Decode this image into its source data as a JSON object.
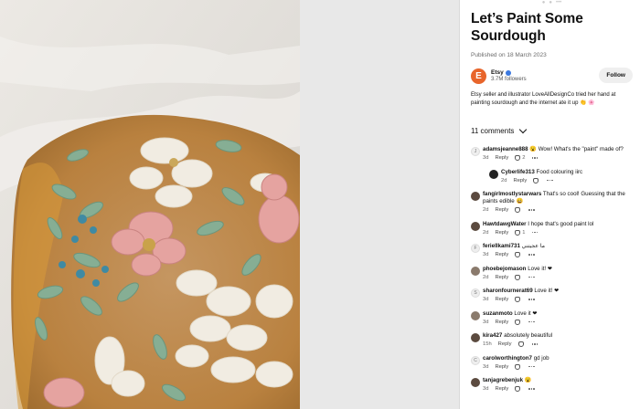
{
  "pin": {
    "title_line1": "Let’s Paint Some",
    "title_line2": "Sourdough",
    "published": "Published on 18 March 2023",
    "author_initial": "E",
    "author_name": "Etsy",
    "followers": "3.7M followers",
    "follow_label": "Follow",
    "description": "Etsy seller and illustrator LoveAllDesignCo tried her hand at painting sourdough and the internet ate it up 👏 🌸"
  },
  "comments_header": "11 comments",
  "comments": [
    {
      "avatar": "J",
      "style": "letter",
      "user": "adamsjeanne888",
      "text": "😮 Wow! What's the \"paint\" made of?",
      "time": "3d",
      "reply": "Reply",
      "likes": "2",
      "is_reply": false
    },
    {
      "avatar": "",
      "style": "dark",
      "user": "Cyberlife313",
      "text": "Food colouring iirc",
      "time": "2d",
      "reply": "Reply",
      "likes": "",
      "is_reply": true
    },
    {
      "avatar": "",
      "style": "photo",
      "user": "fangirlmostlystarwars",
      "text": "That's so cool! Guessing that the paints edible 😄",
      "time": "2d",
      "reply": "Reply",
      "likes": "",
      "is_reply": false
    },
    {
      "avatar": "",
      "style": "photo",
      "user": "HawtdawgWater",
      "text": "I hope that's good paint lol",
      "time": "2d",
      "reply": "Reply",
      "likes": "1",
      "is_reply": false
    },
    {
      "avatar": "F",
      "style": "letter",
      "user": "feriellkami731",
      "text": "ما عجيتني",
      "time": "3d",
      "reply": "Reply",
      "likes": "",
      "is_reply": false
    },
    {
      "avatar": "",
      "style": "mid",
      "user": "phoebejomason",
      "text": "Love it! ❤",
      "time": "2d",
      "reply": "Reply",
      "likes": "",
      "is_reply": false
    },
    {
      "avatar": "S",
      "style": "letter",
      "user": "sharonfournerat69",
      "text": "Love it! ❤",
      "time": "3d",
      "reply": "Reply",
      "likes": "",
      "is_reply": false
    },
    {
      "avatar": "",
      "style": "mid",
      "user": "suzanmoto",
      "text": "Love it ❤",
      "time": "3d",
      "reply": "Reply",
      "likes": "",
      "is_reply": false
    },
    {
      "avatar": "",
      "style": "photo",
      "user": "kira427",
      "text": "absolutely beautiful",
      "time": "15h",
      "reply": "Reply",
      "likes": "",
      "is_reply": false
    },
    {
      "avatar": "C",
      "style": "letter",
      "user": "carolworthington7",
      "text": "gd job",
      "time": "3d",
      "reply": "Reply",
      "likes": "",
      "is_reply": false
    },
    {
      "avatar": "",
      "style": "photo",
      "user": "tanjagrebenjuk",
      "text": "😮",
      "time": "3d",
      "reply": "Reply",
      "likes": "",
      "is_reply": false
    }
  ],
  "colors": {
    "brand_orange": "#e8652b",
    "verified_blue": "#3a78e0",
    "follow_bg": "#efefef"
  }
}
